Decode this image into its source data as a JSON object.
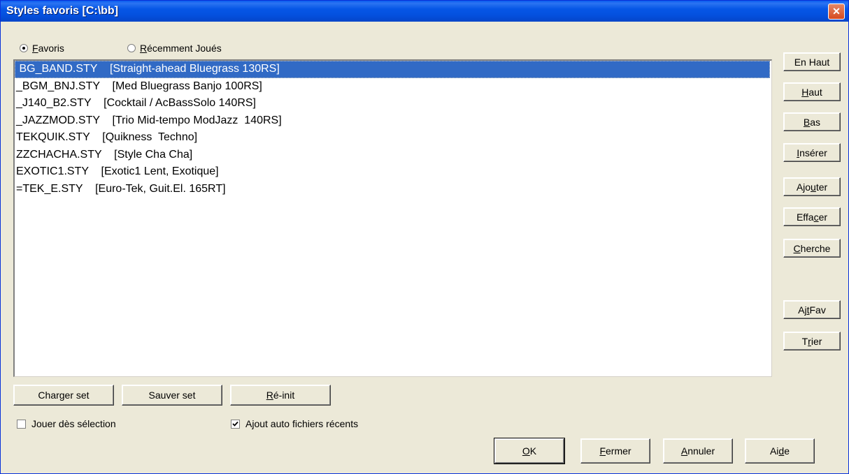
{
  "window": {
    "title": "Styles favoris [C:\\bb]",
    "close_glyph": "✕"
  },
  "radios": [
    {
      "label_u": "F",
      "label_rest": "avoris",
      "checked": true
    },
    {
      "label_u": "R",
      "label_rest": "écemment Joués",
      "checked": false
    }
  ],
  "list": {
    "selected_index": 0,
    "items": [
      " BG_BAND.STY    [Straight-ahead Bluegrass 130RS]",
      "_BGM_BNJ.STY    [Med Bluegrass Banjo 100RS]",
      "_J140_B2.STY    [Cocktail / AcBassSolo 140RS]",
      "_JAZZMOD.STY    [Trio Mid-tempo ModJazz  140RS]",
      "TEKQUIK.STY    [Quikness  Techno]",
      "ZZCHACHA.STY    [Style Cha Cha]",
      "EXOTIC1.STY    [Exotic1 Lent, Exotique]",
      "=TEK_E.STY    [Euro-Tek, Guit.El. 165RT]"
    ]
  },
  "side_buttons": {
    "en_haut": "En Haut",
    "haut_u": "H",
    "haut_rest": "aut",
    "bas_u": "B",
    "bas_rest": "as",
    "inserer_u": "I",
    "inserer_rest": "nsérer",
    "ajouter_pre": "Ajo",
    "ajouter_u": "u",
    "ajouter_rest": "ter",
    "effacer_pre": "Effa",
    "effacer_u": "c",
    "effacer_rest": "er",
    "cherche_u": "C",
    "cherche_rest": "herche",
    "ajt_fav_pre": "Aj",
    "ajt_fav_u": "t",
    "ajt_fav_rest": " Fav",
    "trier_pre": "T",
    "trier_u": "r",
    "trier_rest": "ier"
  },
  "bottom_buttons": {
    "charger_set": "Charger set",
    "sauver_set": "Sauver set",
    "reinit_u": "R",
    "reinit_rest": "é-init"
  },
  "checkboxes": [
    {
      "label": "Jouer dès sélection",
      "checked": false
    },
    {
      "label": "Ajout auto fichiers récents",
      "checked": true
    }
  ],
  "dialog_buttons": {
    "ok_u": "O",
    "ok_rest": "K",
    "fermer_u": "F",
    "fermer_rest": "ermer",
    "annuler_u": "A",
    "annuler_rest": "nnuler",
    "aide_pre": "Ai",
    "aide_u": "d",
    "aide_rest": "e"
  },
  "colors": {
    "selection": "#316ac5",
    "titlebar": "#0450de",
    "close": "#d64a1f"
  }
}
